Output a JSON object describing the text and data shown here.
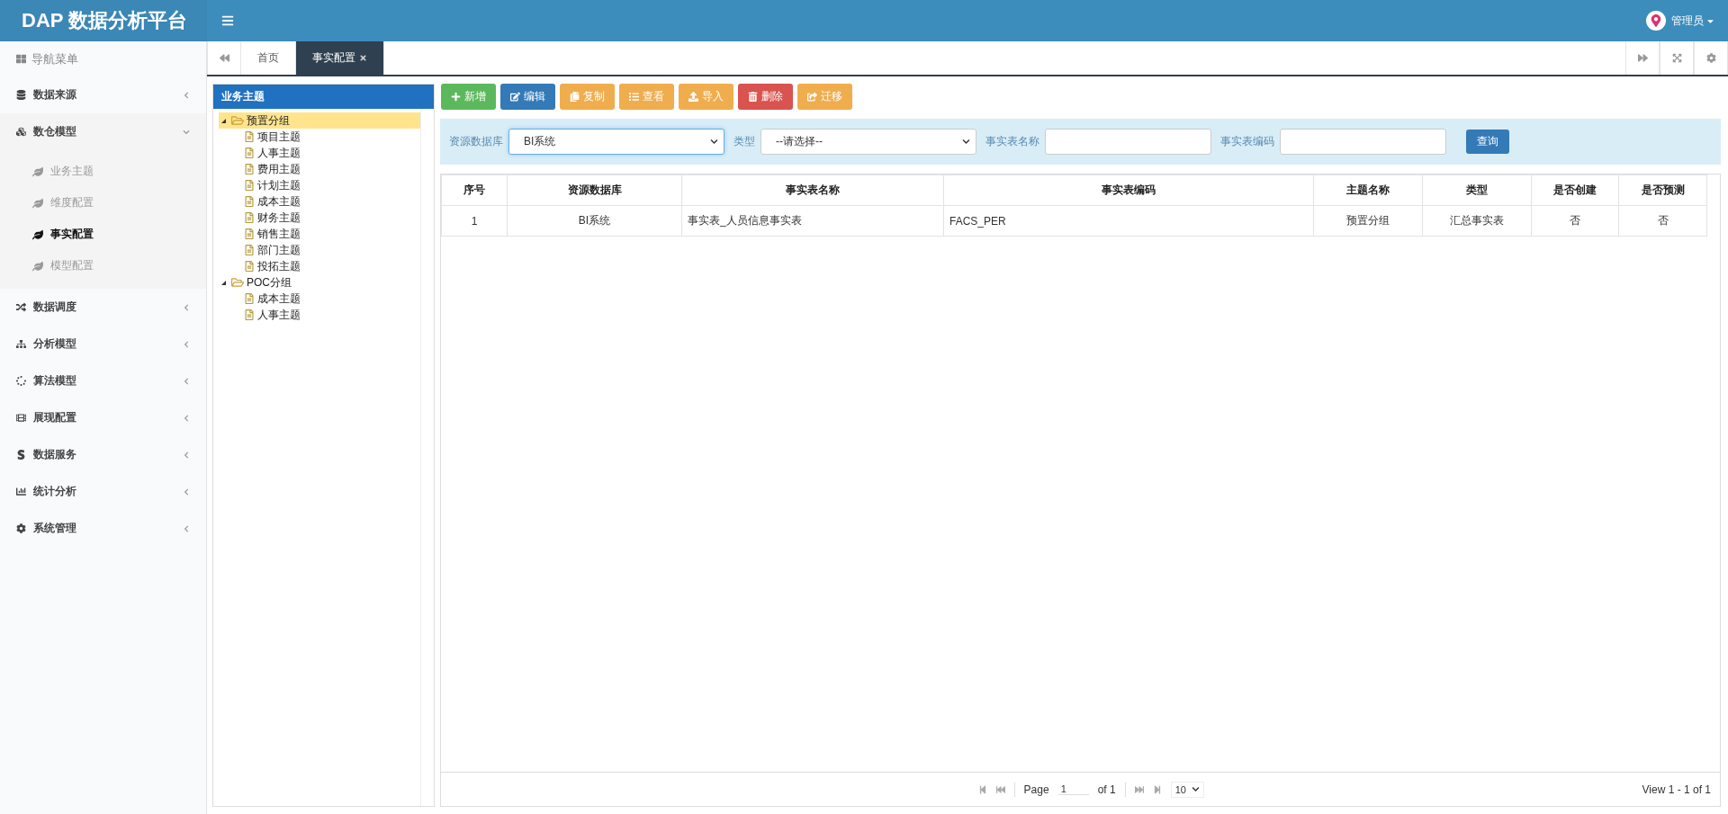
{
  "header": {
    "logo": "DAP 数据分析平台",
    "user": "管理员"
  },
  "sidebar": {
    "title": "导航菜单",
    "items": [
      {
        "label": "数据来源",
        "expanded": false
      },
      {
        "label": "数仓模型",
        "expanded": true,
        "children": [
          {
            "label": "业务主题",
            "selected": false
          },
          {
            "label": "维度配置",
            "selected": false
          },
          {
            "label": "事实配置",
            "selected": true
          },
          {
            "label": "模型配置",
            "selected": false
          }
        ]
      },
      {
        "label": "数据调度",
        "expanded": false
      },
      {
        "label": "分析模型",
        "expanded": false
      },
      {
        "label": "算法模型",
        "expanded": false
      },
      {
        "label": "展现配置",
        "expanded": false
      },
      {
        "label": "数据服务",
        "expanded": false
      },
      {
        "label": "统计分析",
        "expanded": false
      },
      {
        "label": "系统管理",
        "expanded": false
      }
    ]
  },
  "tabs": [
    {
      "label": "首页",
      "selected": false,
      "closable": false
    },
    {
      "label": "事实配置",
      "selected": true,
      "closable": true
    }
  ],
  "tree": {
    "title": "业务主题",
    "nodes": [
      {
        "label": "预置分组",
        "selected": true,
        "expanded": true,
        "children": [
          {
            "label": "项目主题",
            "selected": false
          },
          {
            "label": "人事主题",
            "selected": false
          },
          {
            "label": "费用主题",
            "selected": false
          },
          {
            "label": "计划主题",
            "selected": false
          },
          {
            "label": "成本主题",
            "selected": false
          },
          {
            "label": "财务主题",
            "selected": false
          },
          {
            "label": "销售主题",
            "selected": false
          },
          {
            "label": "部门主题",
            "selected": false
          },
          {
            "label": "投拓主题",
            "selected": false
          }
        ]
      },
      {
        "label": "POC分组",
        "selected": false,
        "expanded": true,
        "children": [
          {
            "label": "成本主题",
            "selected": false
          },
          {
            "label": "人事主题",
            "selected": false
          }
        ]
      }
    ]
  },
  "toolbar": [
    {
      "label": "新增",
      "kind": "success"
    },
    {
      "label": "编辑",
      "kind": "primary"
    },
    {
      "label": "复制",
      "kind": "warning"
    },
    {
      "label": "查看",
      "kind": "warning"
    },
    {
      "label": "导入",
      "kind": "warning"
    },
    {
      "label": "删除",
      "kind": "danger"
    },
    {
      "label": "迁移",
      "kind": "warning"
    }
  ],
  "filters": [
    {
      "label": "资源数据库",
      "kind": "select",
      "value": "BI系统",
      "focused": true
    },
    {
      "label": "类型",
      "kind": "select",
      "value": "--请选择--",
      "focused": false
    },
    {
      "label": "事实表名称",
      "kind": "text",
      "focused": false
    },
    {
      "label": "事实表编码",
      "kind": "text",
      "focused": false
    }
  ],
  "query_button": "查询",
  "table": {
    "columns": [
      "序号",
      "资源数据库",
      "事实表名称",
      "事实表编码",
      "主题名称",
      "类型",
      "是否创建",
      "是否预测"
    ],
    "rows": [
      [
        "1",
        "BI系统",
        "事实表_人员信息事实表",
        "FACS_PER",
        "预置分组",
        "汇总事实表",
        "否",
        "否"
      ]
    ]
  },
  "pager": {
    "page_label": "Page",
    "page": "1",
    "of": "of 1",
    "page_size": "10",
    "view": "View 1 - 1 of 1"
  }
}
